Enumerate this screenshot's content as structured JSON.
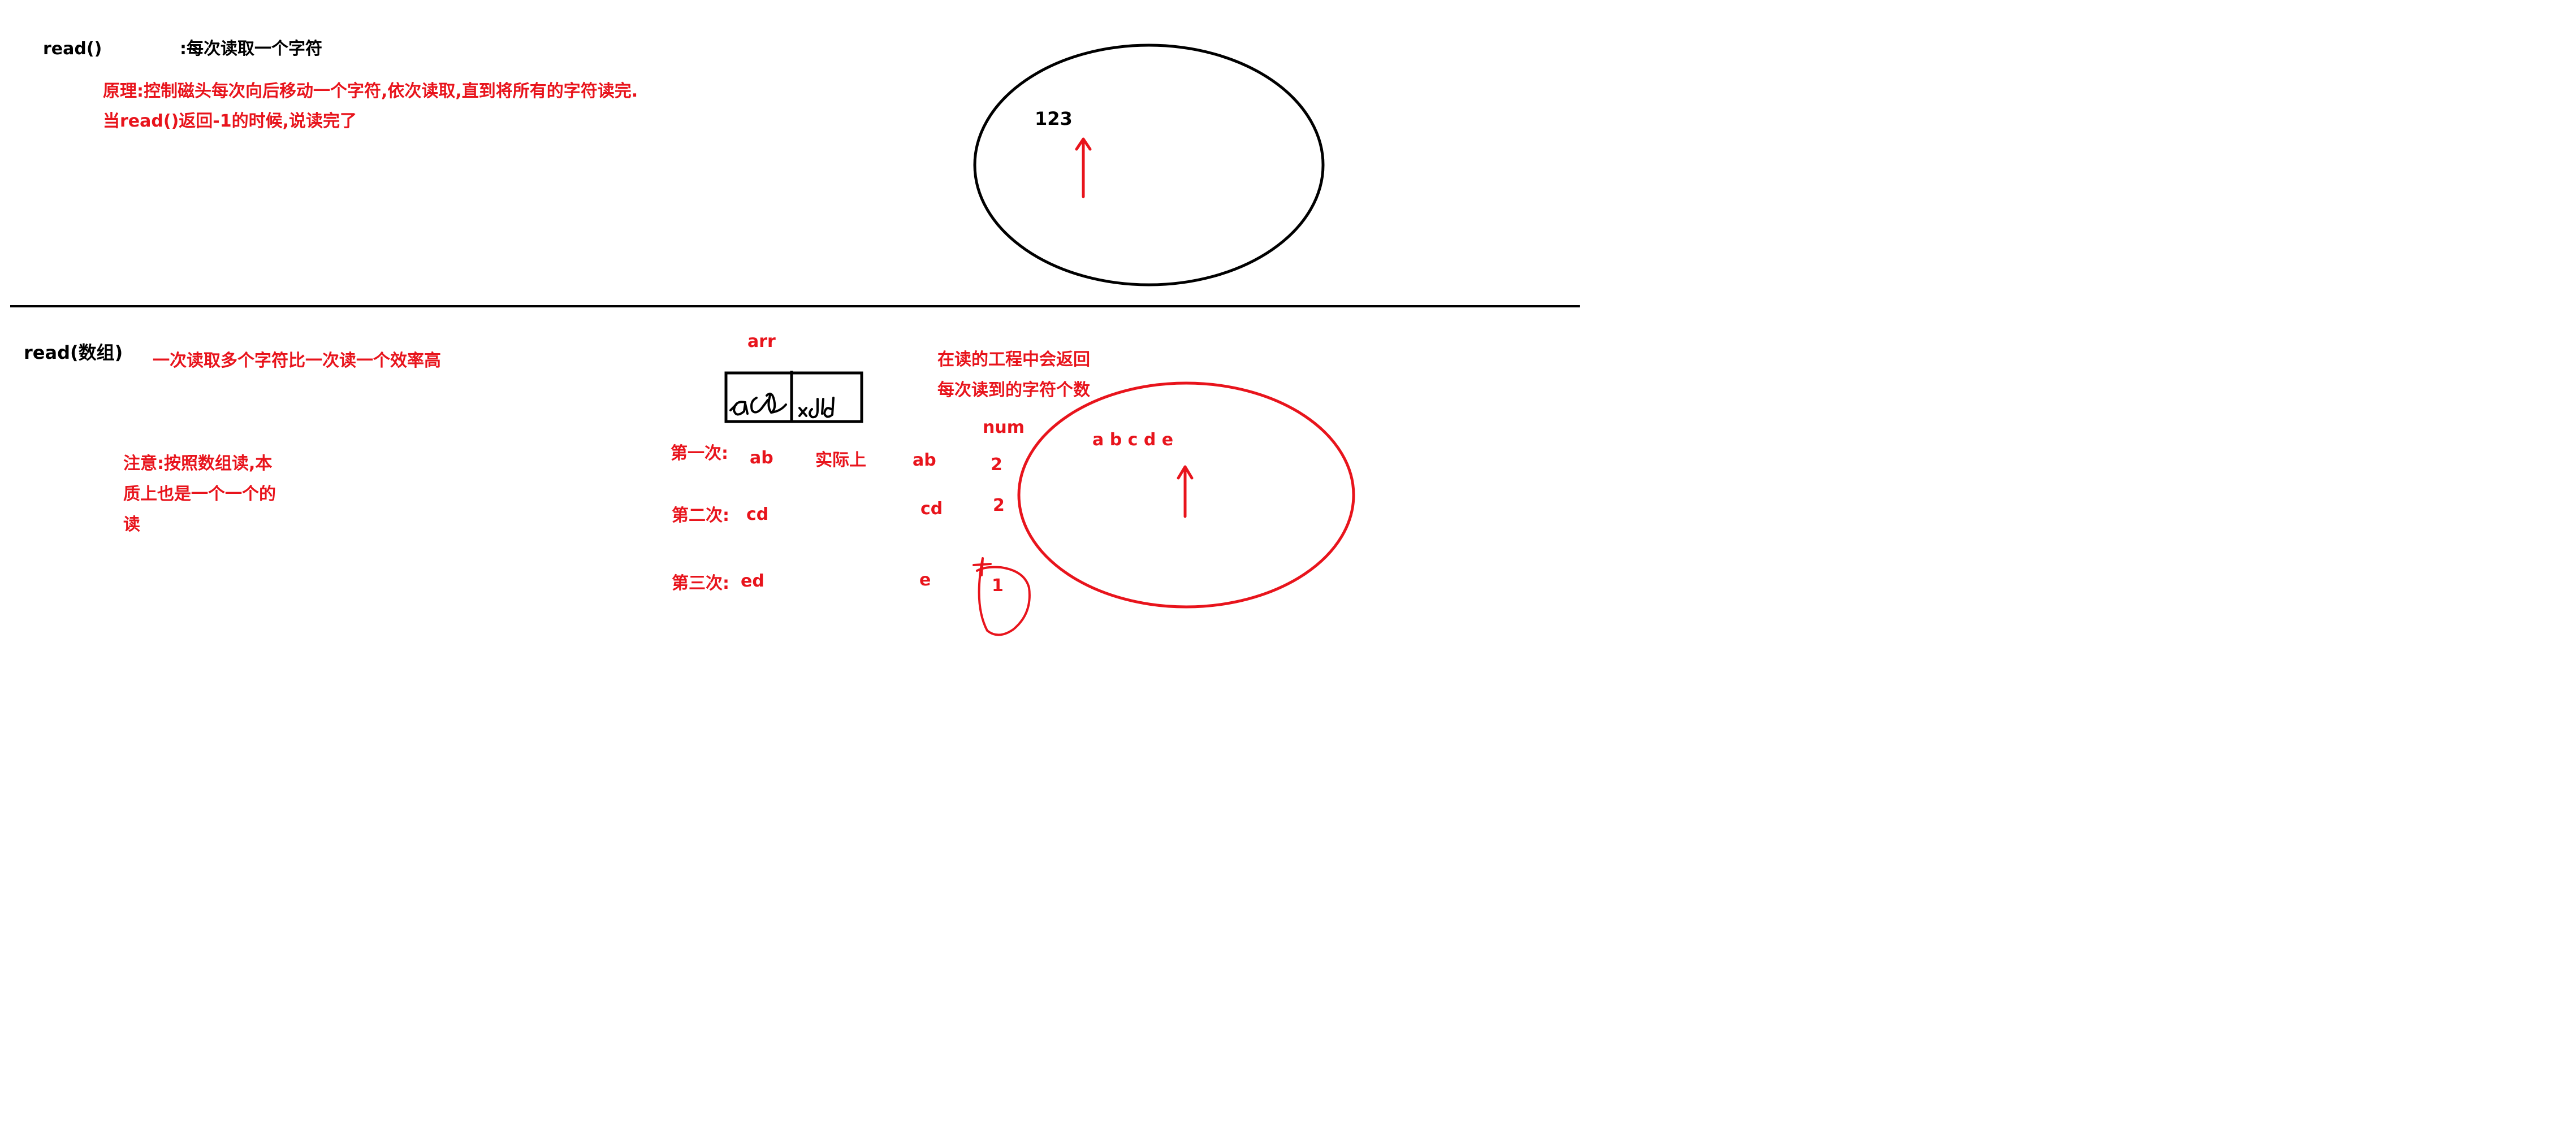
{
  "colors": {
    "ink": "#000000",
    "marker": "#e8141c",
    "background": "#ffffff"
  },
  "top_section": {
    "method_label": "read()",
    "method_desc": ":每次读取一个字符",
    "principle_line1": "原理:控制磁头每次向后移动一个字符,依次读取,直到将所有的字符读完.",
    "principle_line2": "当read()返回-1的时候,说读完了",
    "file_content": "123"
  },
  "bottom_section": {
    "method_label": "read(数组)",
    "efficiency_note": "一次读取多个字符比一次读一个效率高",
    "note_line1": "注意:按照数组读,本",
    "note_line2": "质上也是一个一个的",
    "note_line3": "读",
    "array_label": "arr",
    "return_note_line1": "在读的工程中会返回",
    "return_note_line2": "每次读到的字符个数",
    "num_header": "num",
    "file_content": "a b c d e",
    "actual_label": "实际上",
    "rows": [
      {
        "label": "第一次:",
        "array_content": "ab",
        "actual": "ab",
        "num": "2"
      },
      {
        "label": "第二次:",
        "array_content": "cd",
        "actual": "cd",
        "num": "2"
      },
      {
        "label": "第三次:",
        "array_content": "ed",
        "actual": "e",
        "num": "1"
      }
    ]
  }
}
